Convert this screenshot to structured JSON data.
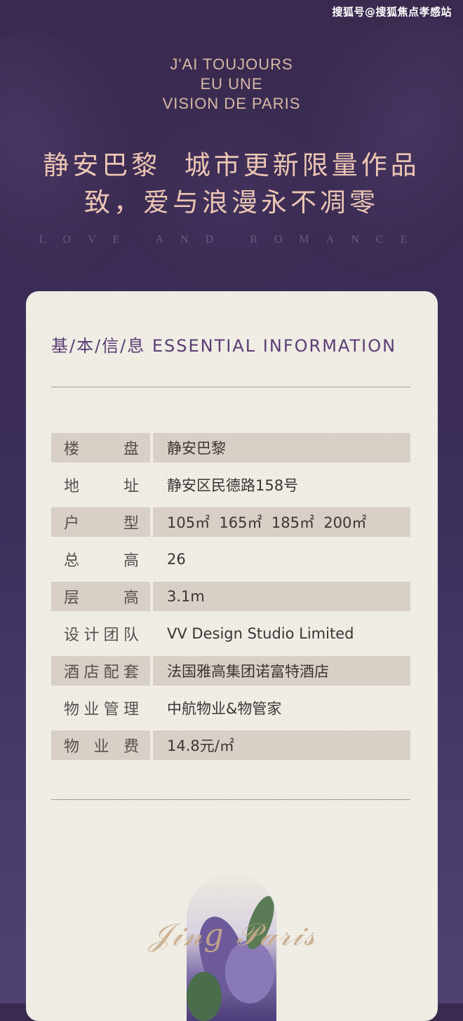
{
  "watermark": "搜狐号@搜狐焦点孝感站",
  "header": {
    "en_line1": "J'AI TOUJOURS",
    "en_line2": "EU UNE",
    "en_line3": "VISION DE PARIS",
    "cn_line1": "静安巴黎  城市更新限量作品",
    "cn_line2": "致，爱与浪漫永不凋零",
    "tagline": "LOVE AND ROMANCE"
  },
  "card": {
    "section_title": "基/本/信/息 ESSENTIAL INFORMATION",
    "rows": [
      {
        "label": [
          "楼",
          "盘"
        ],
        "value": "静安巴黎",
        "shaded": true
      },
      {
        "label": [
          "地",
          "址"
        ],
        "value": "静安区民德路158号",
        "shaded": false
      },
      {
        "label": [
          "户",
          "型"
        ],
        "value": "105㎡  165㎡  185㎡  200㎡",
        "shaded": true
      },
      {
        "label": [
          "总",
          "高"
        ],
        "value": "26",
        "shaded": false
      },
      {
        "label": [
          "层",
          "高"
        ],
        "value": "3.1m",
        "shaded": true
      },
      {
        "label": [
          "设",
          "计",
          "团",
          "队"
        ],
        "value": "VV Design Studio Limited",
        "shaded": false
      },
      {
        "label": [
          "酒",
          "店",
          "配",
          "套"
        ],
        "value": "法国雅高集团诺富特酒店",
        "shaded": true
      },
      {
        "label": [
          "物",
          "业",
          "管",
          "理"
        ],
        "value": "中航物业&物管家",
        "shaded": false
      },
      {
        "label": [
          "物",
          "业",
          "费"
        ],
        "value": "14.8元/㎡",
        "shaded": true
      }
    ],
    "script_logo": "Jing'an Paris"
  },
  "colors": {
    "background": "#3b2c55",
    "card": "#f1eee6",
    "title_purple": "#5a3d73",
    "row_shade": "#d8d0c6",
    "header_gold": "#ecc6b3"
  }
}
